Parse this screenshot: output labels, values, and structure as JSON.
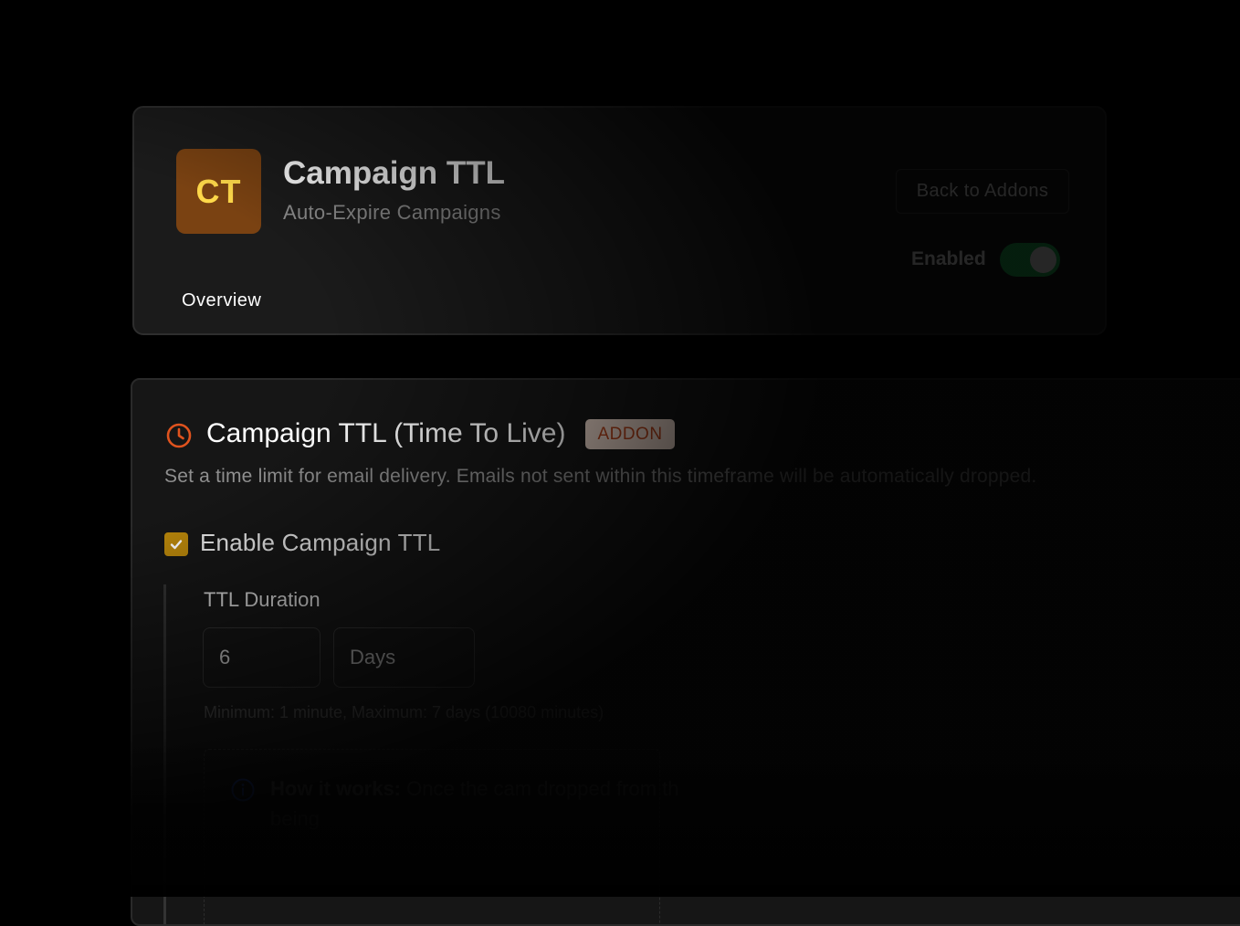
{
  "addon": {
    "logo_initials": "CT",
    "title": "Campaign TTL",
    "subtitle": "Auto-Expire Campaigns",
    "back_label": "Back to Addons",
    "enabled_label": "Enabled",
    "enabled": true,
    "tab": "Overview"
  },
  "settings": {
    "icon": "clock-icon",
    "title": "Campaign TTL (Time To Live)",
    "badge": "ADDON",
    "description": "Set a time limit for email delivery. Emails not sent within this timeframe will be automatically dropped.",
    "enable_label": "Enable Campaign TTL",
    "enable_checked": true,
    "duration_label": "TTL Duration",
    "duration_value": "6",
    "duration_unit": "Days",
    "hint": "Minimum: 1 minute, Maximum: 7 days (10080 minutes)",
    "info": {
      "icon": "info-icon",
      "heading": "How it works:",
      "body": "Once the cam dropped from th being"
    }
  },
  "colors": {
    "logo_bg": "#7a4212",
    "logo_text": "#ffd94a",
    "toggle_on": "#1fc55a",
    "badge_bg": "#e8d3c7",
    "badge_text": "#b5421a",
    "checkbox": "#b8860b",
    "clock": "#e0531e"
  }
}
